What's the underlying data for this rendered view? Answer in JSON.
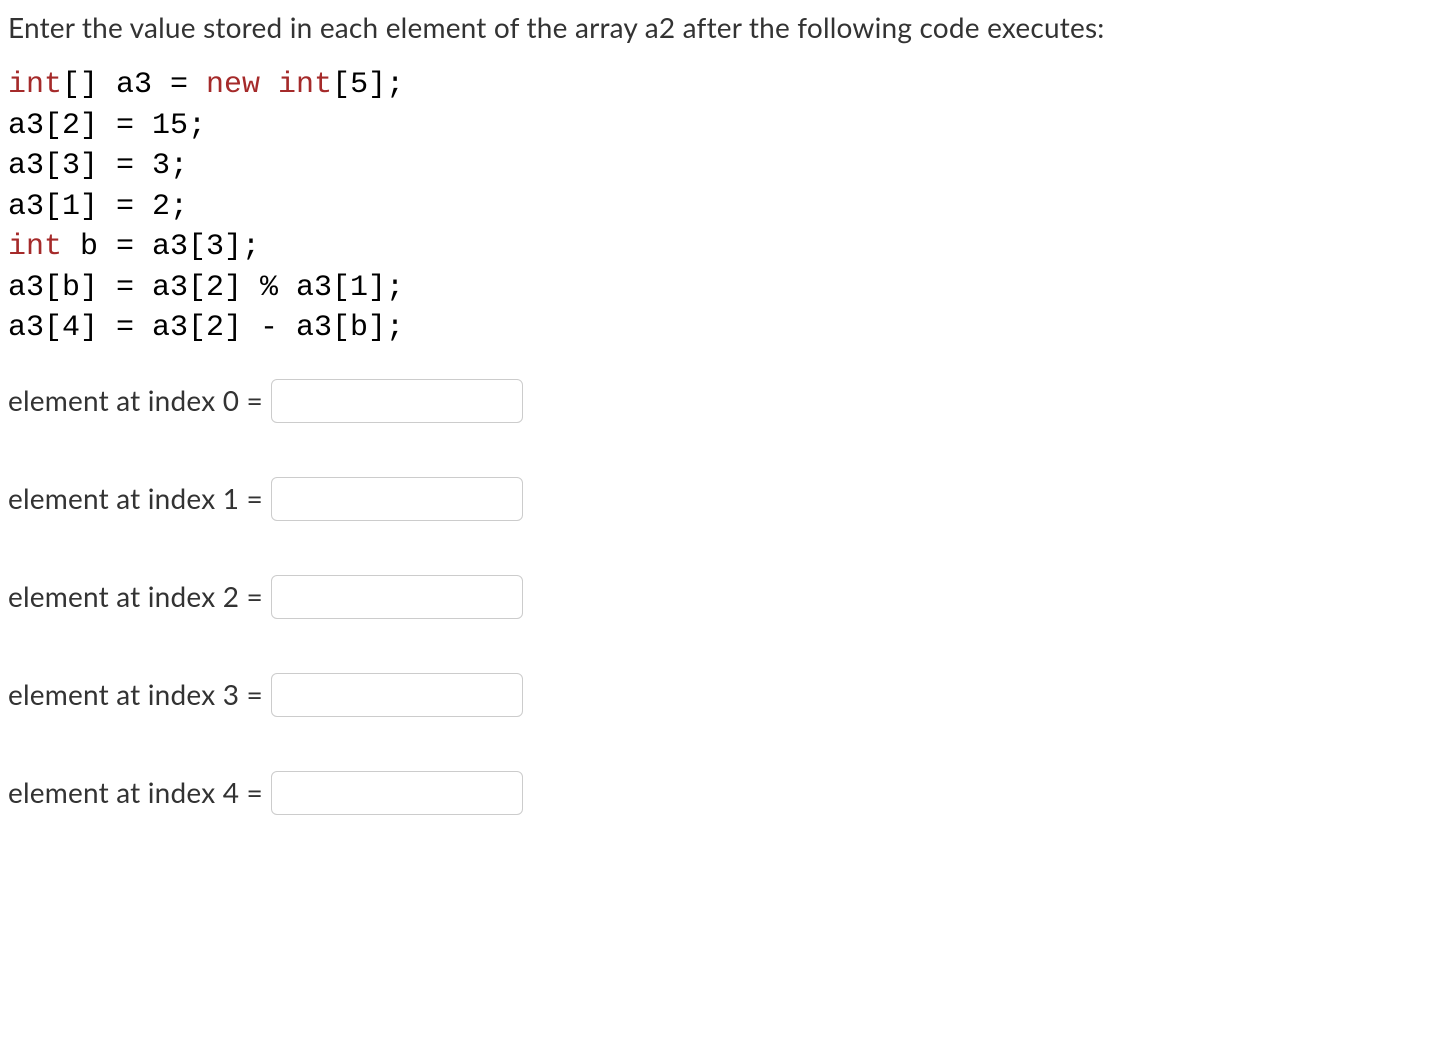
{
  "prompt": "Enter the value stored in each element of the array a2 after the following code executes:",
  "code": {
    "kw1": "int",
    "line1_rest": "[] a3 = ",
    "kw2": "new int",
    "line1_end": "[5];",
    "line2": "a3[2] = 15;",
    "line3": "a3[3] = 3;",
    "line4": "a3[1] = 2;",
    "kw3": "int",
    "line5_rest": " b = a3[3];",
    "line6": "a3[b] = a3[2] % a3[1];",
    "line7": "a3[4] = a3[2] - a3[b];"
  },
  "answers": [
    {
      "label": "element at index 0 =",
      "value": ""
    },
    {
      "label": "element at index 1 =",
      "value": ""
    },
    {
      "label": "element at index 2 =",
      "value": ""
    },
    {
      "label": "element at index 3 =",
      "value": ""
    },
    {
      "label": "element at index 4 =",
      "value": ""
    }
  ]
}
